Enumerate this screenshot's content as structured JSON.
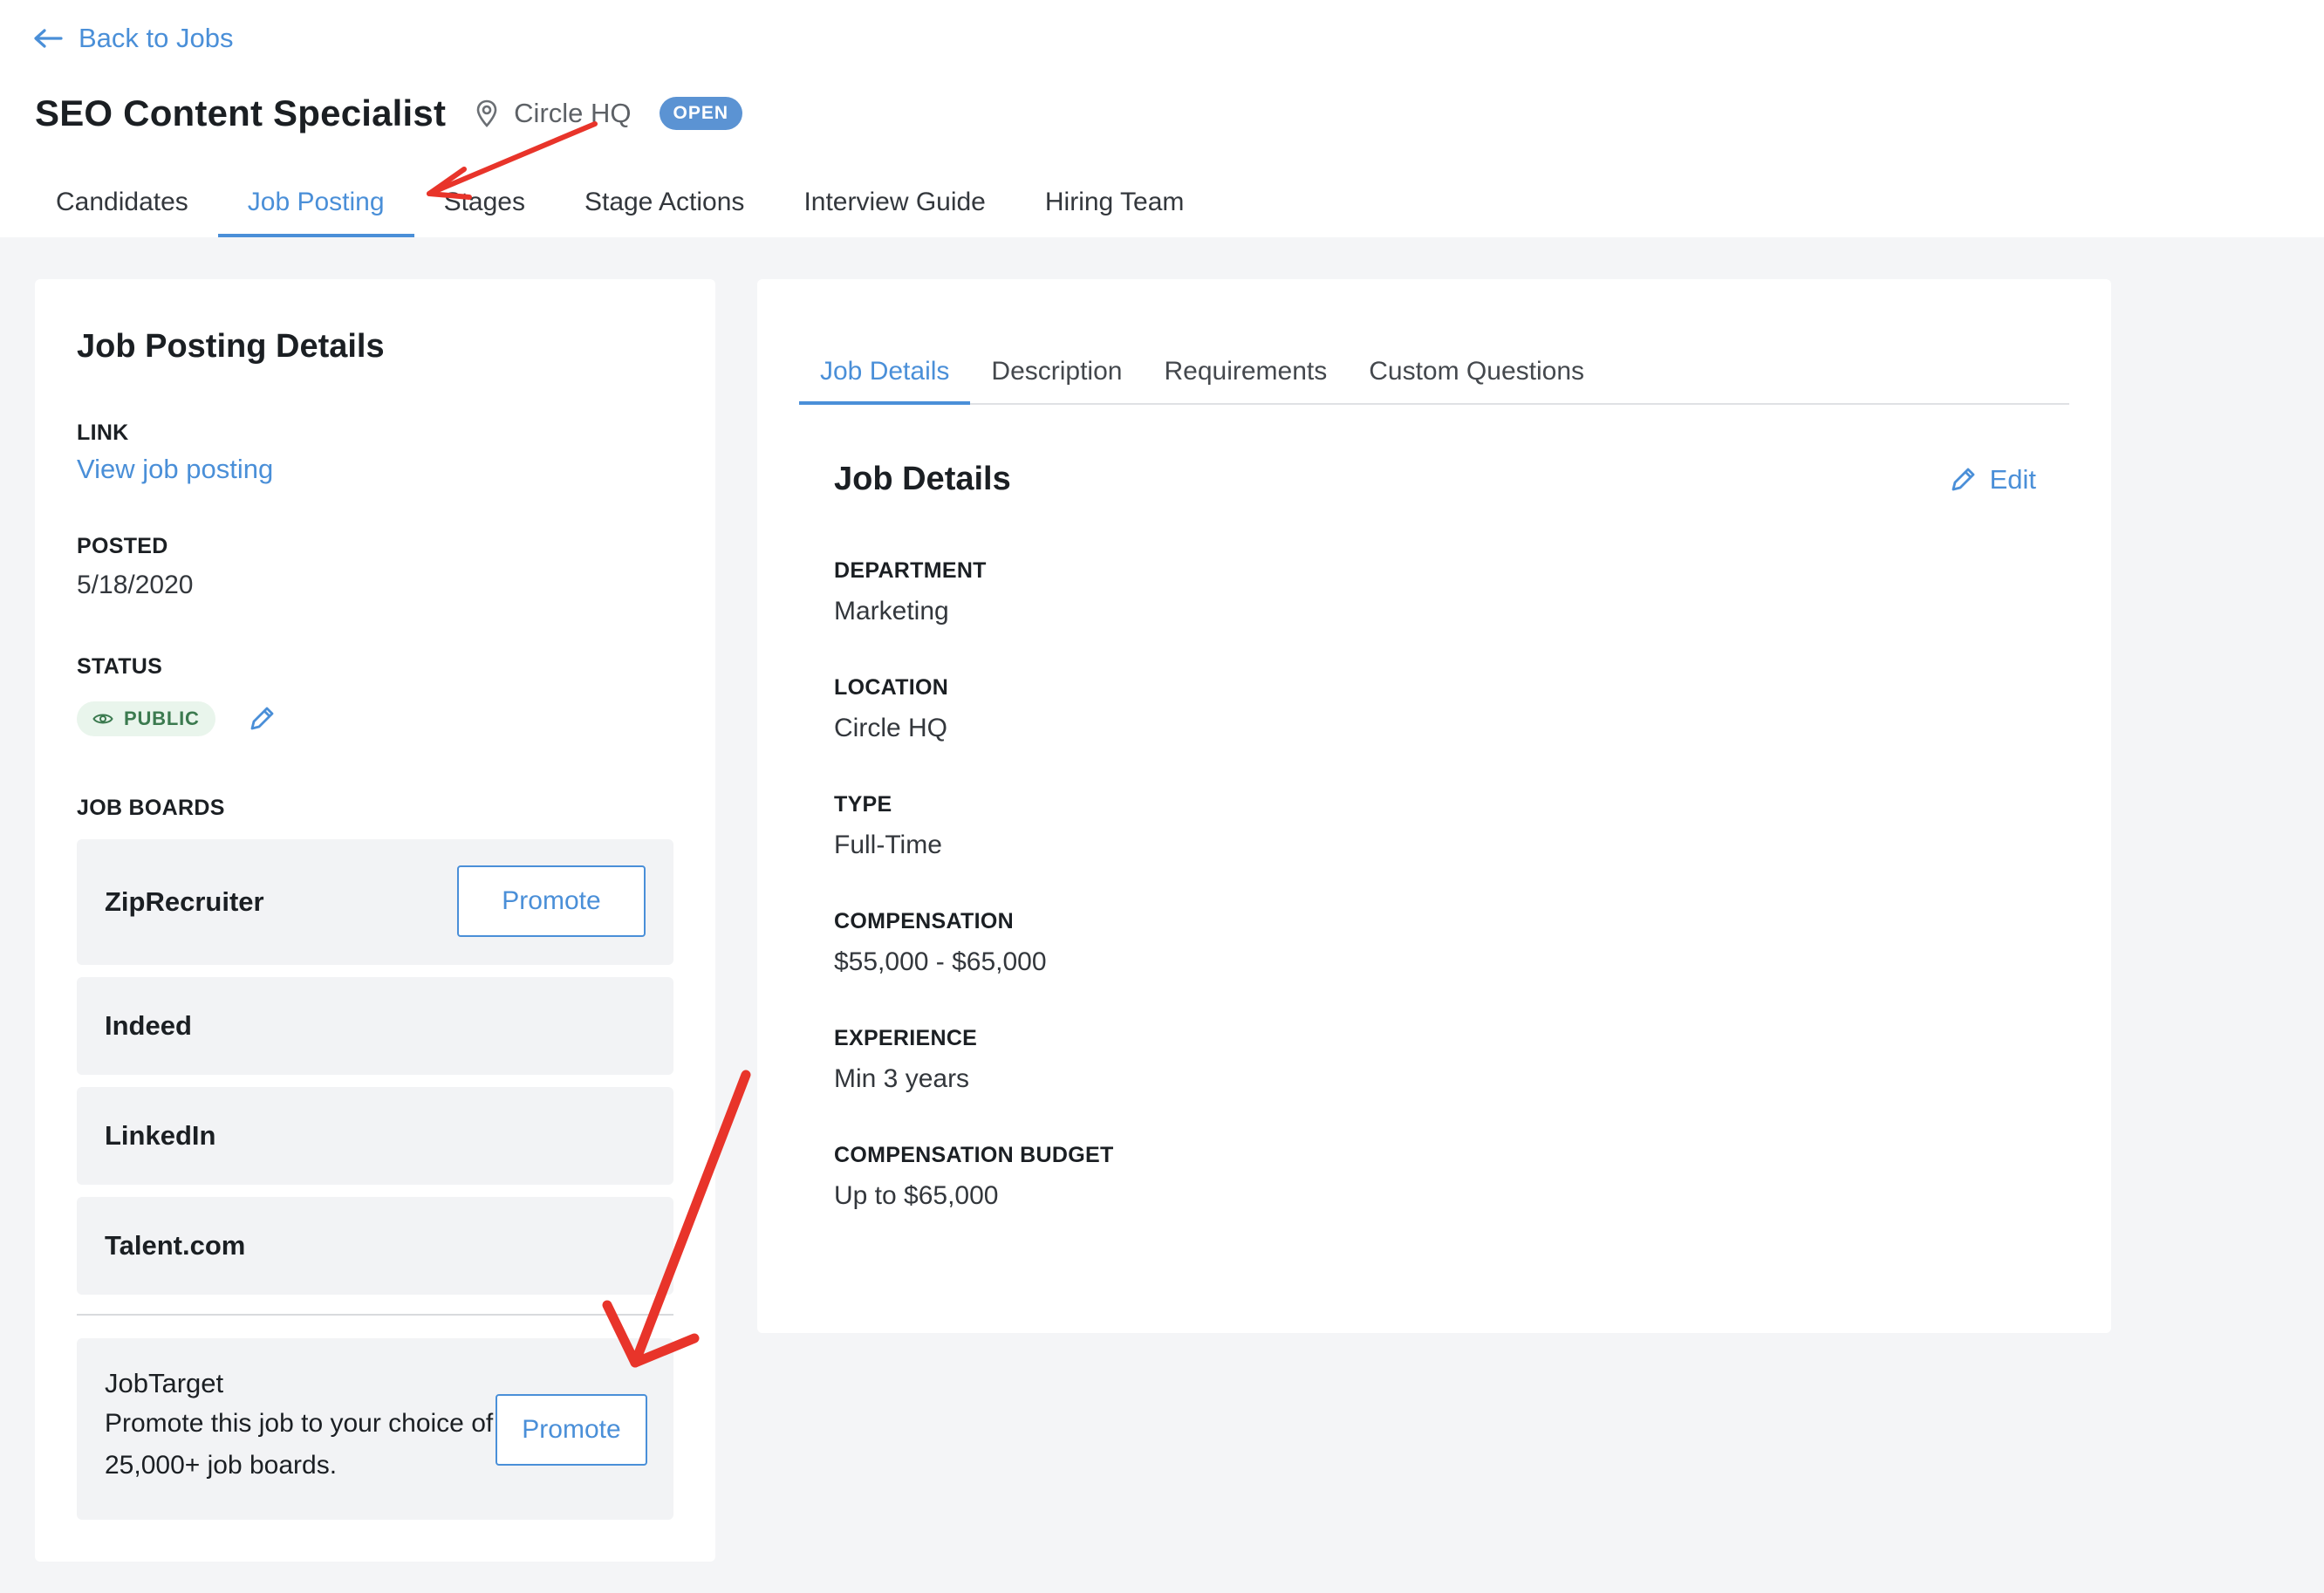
{
  "header": {
    "back_label": "Back to Jobs",
    "job_title": "SEO Content Specialist",
    "location": "Circle HQ",
    "status_badge": "OPEN",
    "tabs": [
      {
        "label": "Candidates"
      },
      {
        "label": "Job Posting"
      },
      {
        "label": "Stages"
      },
      {
        "label": "Stage Actions"
      },
      {
        "label": "Interview Guide"
      },
      {
        "label": "Hiring Team"
      }
    ],
    "active_tab": "Job Posting"
  },
  "posting": {
    "title": "Job Posting Details",
    "link_label": "LINK",
    "link_text": "View job posting",
    "posted_label": "POSTED",
    "posted_value": "5/18/2020",
    "status_label": "STATUS",
    "status_value": "PUBLIC",
    "boards_label": "JOB BOARDS",
    "boards": [
      {
        "name": "ZipRecruiter",
        "button": "Promote"
      },
      {
        "name": "Indeed"
      },
      {
        "name": "LinkedIn"
      },
      {
        "name": "Talent.com"
      }
    ],
    "jobtarget": {
      "name": "JobTarget",
      "description": "Promote this job to your choice of 25,000+ job boards.",
      "button": "Promote"
    }
  },
  "details": {
    "tabs": [
      {
        "label": "Job Details"
      },
      {
        "label": "Description"
      },
      {
        "label": "Requirements"
      },
      {
        "label": "Custom Questions"
      }
    ],
    "active_tab": "Job Details",
    "title": "Job Details",
    "edit_label": "Edit",
    "fields": [
      {
        "label": "DEPARTMENT",
        "value": "Marketing"
      },
      {
        "label": "LOCATION",
        "value": "Circle HQ"
      },
      {
        "label": "TYPE",
        "value": "Full-Time"
      },
      {
        "label": "COMPENSATION",
        "value": "$55,000 - $65,000"
      },
      {
        "label": "EXPERIENCE",
        "value": "Min 3 years"
      },
      {
        "label": "COMPENSATION BUDGET",
        "value": "Up to $65,000"
      }
    ]
  },
  "colors": {
    "accent": "#4a8fd8",
    "open_badge": "#5b93d3",
    "public_badge_bg": "#e9f5ec",
    "public_badge_text": "#3b7a4f",
    "annotation_arrow": "#e8342a"
  },
  "icons": {
    "back": "arrow-left-icon",
    "location": "map-pin-icon",
    "public": "eye-icon",
    "edit": "pencil-icon"
  }
}
